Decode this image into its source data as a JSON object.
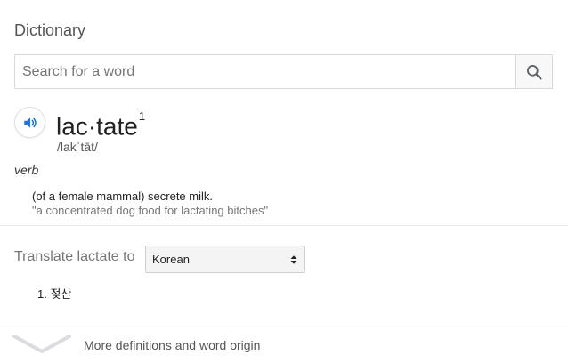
{
  "dictionary": {
    "title": "Dictionary",
    "search": {
      "placeholder": "Search for a word",
      "value": "",
      "icon": "search-icon"
    },
    "entry": {
      "headword": "lac·tate",
      "superscript": "1",
      "phonetic": "/lakˈtāt/",
      "part_of_speech": "verb",
      "definition": "(of a female mammal) secrete milk.",
      "example": "\"a concentrated dog food for lactating bitches\"",
      "audio_icon": "speaker-icon"
    },
    "translate": {
      "label": "Translate lactate to",
      "selected_language": "Korean",
      "results": [
        "1. 젖산"
      ]
    },
    "more": {
      "label": "More definitions and word origin",
      "icon": "chevron-down-icon"
    }
  },
  "colors": {
    "accent_blue": "#1a73e8",
    "muted_text": "#777777"
  }
}
